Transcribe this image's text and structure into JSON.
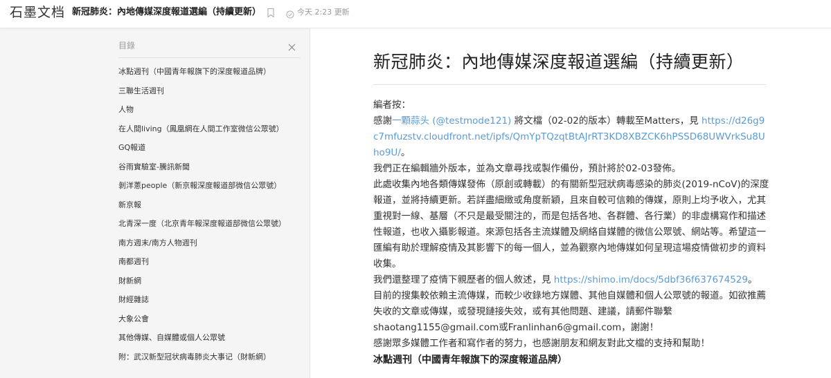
{
  "topbar": {
    "logo": "石墨文档",
    "doc_title": "新冠肺炎：內地傳媒深度報道選編（持續更新）",
    "status": "今天 2:23 更新"
  },
  "toc": {
    "header": "目錄",
    "items": [
      "冰點週刊（中國青年報旗下的深度報道品牌）",
      "三聯生活週刊",
      "人物",
      "在人間living（鳳凰網在人間工作室微信公眾號）",
      "GQ報道",
      "谷雨實驗室-騰訊新聞",
      "剝洋蔥people（新京報深度報道部微信公眾號）",
      "新京報",
      "北青深一度（北京青年報深度報道部微信公眾號）",
      "南方週末/南方人物週刊",
      "南都週刊",
      "財新網",
      "財經雜誌",
      "大象公會",
      "其他傳媒、自媒體或個人公眾號",
      "附：武汉新型冠状病毒肺炎大事记（財新網）"
    ]
  },
  "doc": {
    "title": "新冠肺炎：內地傳媒深度報道選編（持續更新）",
    "editor_note": "編者按：",
    "p1_a": "感謝",
    "p1_link1": "一顆蒜头 (@testmode121)",
    "p1_b": " 將文檔（02-02的版本）轉載至Matters，見 ",
    "p1_link2": "https://d26g9c7mfuzstv.cloudfront.net/ipfs/QmYpTQzqtBtAJrRT3KD8XBZCK6hPSSD68UWVrkSu8Uho9U/",
    "p1_c": "。",
    "p2": "我們正在編輯牆外版本，並為文章尋找或製作備份，預計將於02-03發佈。",
    "p3": "此處收集內地各類傳媒發佈（原創或轉載）的有關新型冠狀病毒感染的肺炎(2019-nCoV)的深度報道，並將持續更新。若詳盡細緻或角度新穎，且來自較可信賴的傳媒，原則上均予收入，尤其重視對一線、基層（不只是最受關注的，而是包括各地、各群體、各行業）的非虛構寫作和描述性報道，也收入攝影報道。來源包括各主流媒體及網絡自媒體的微信公眾號、網站等。希望這一匯編有助於理解疫情及其影響下的每一個人，並為觀察內地傳媒如何呈現這場疫情做初步的資料收集。",
    "p4_a": "我們還整理了疫情下親歷者的個人敘述，見 ",
    "p4_link": "https://shimo.im/docs/5dbf36f637674529",
    "p4_b": "。",
    "p5": "目前的搜集較依賴主流傳媒，而較少收錄地方媒體、其他自媒體和個人公眾號的報道。如欲推薦失收的文章或傳媒，或發現鏈接失效，或有其他問題、建議，請郵件聯繫shaotang1155@gmail.com或Franlinhan6@gmail.com，謝謝！",
    "p6": "感謝眾多媒體工作者和寫作者的努力，也感謝朋友和網友對此文檔的支持和幫助！",
    "section1": "冰點週刊（中國青年報旗下的深度報道品牌）"
  },
  "colors": {
    "link": "#5b9bd5",
    "panel_bg": "#f5f5f5"
  },
  "icons": {
    "bookmark": "bookmark-icon",
    "status": "check-circle-icon",
    "close": "close-icon"
  }
}
